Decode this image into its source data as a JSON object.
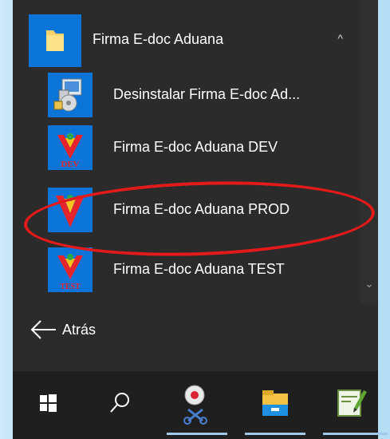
{
  "start_menu": {
    "folder": {
      "label": "Firma E-doc Aduana",
      "icon": "folder-icon",
      "chevron": "^"
    },
    "items": [
      {
        "label": "Desinstalar Firma E-doc Ad...",
        "icon": "uninstall-icon"
      },
      {
        "label": "Firma E-doc Aduana DEV",
        "icon": "dev-icon",
        "badge": "DEV"
      },
      {
        "label": "Firma E-doc Aduana PROD",
        "icon": "prod-icon"
      },
      {
        "label": "Firma E-doc Aduana TEST",
        "icon": "test-icon",
        "badge": "TEST"
      }
    ],
    "back_label": "Atrás",
    "scroll_down": "⌄"
  },
  "taskbar": {
    "buttons": [
      {
        "icon": "windows-start-icon"
      },
      {
        "icon": "search-icon"
      },
      {
        "icon": "snipping-tool-icon"
      },
      {
        "icon": "file-explorer-icon"
      },
      {
        "icon": "notepad-plus-icon"
      }
    ]
  },
  "annotation": {
    "color": "#e21a1a"
  },
  "colors": {
    "tile": "#0a74d9",
    "menu_bg": "#2b2b2b",
    "taskbar_bg": "#1f1f1f"
  }
}
